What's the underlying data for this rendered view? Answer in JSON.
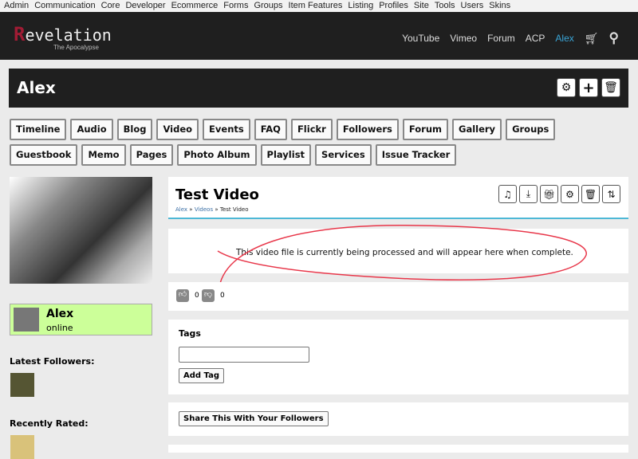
{
  "topnav": [
    "Admin",
    "Communication",
    "Core",
    "Developer",
    "Ecommerce",
    "Forms",
    "Groups",
    "Item Features",
    "Listing",
    "Profiles",
    "Site",
    "Tools",
    "Users",
    "Skins"
  ],
  "logo": {
    "initial": "R",
    "rest": "evelation",
    "tagline": "The Apocalypse"
  },
  "header_nav": [
    "YouTube",
    "Vimeo",
    "Forum",
    "ACP",
    "Alex"
  ],
  "profile": {
    "name": "Alex",
    "status": "online"
  },
  "tabs": [
    "Timeline",
    "Audio",
    "Blog",
    "Video",
    "Events",
    "FAQ",
    "Flickr",
    "Followers",
    "Forum",
    "Gallery",
    "Groups",
    "Guestbook",
    "Memo",
    "Pages",
    "Photo Album",
    "Playlist",
    "Services",
    "Issue Tracker"
  ],
  "sidebar": {
    "latest_followers": "Latest Followers:",
    "recently_rated": "Recently Rated:"
  },
  "video": {
    "title": "Test Video",
    "breadcrumb": [
      "Alex",
      "Videos",
      "Test Video"
    ],
    "sep": "»",
    "message": "This video file is currently being processed and will appear here when complete.",
    "likes": "0",
    "dislikes": "0"
  },
  "tags": {
    "heading": "Tags",
    "input_value": "",
    "add_label": "Add Tag"
  },
  "share_label": "Share This With Your Followers",
  "colors": {
    "accent": "#3aa6d8",
    "logo_red": "#a01c34",
    "online_bg": "#ccff99",
    "annotation": "#e8374a"
  }
}
